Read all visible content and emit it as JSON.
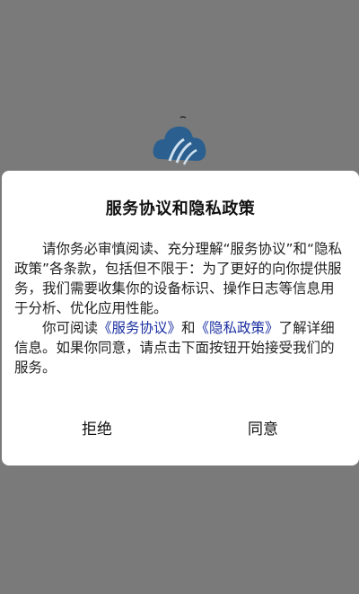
{
  "dialog": {
    "title": "服务协议和隐私政策",
    "paragraph1": "请你务必审慎阅读、充分理解“服务协议”和“隐私政策”各条款，包括但不限于：为了更好的向你提供服务，我们需要收集你的设备标识、操作日志等信息用于分析、优化应用性能。",
    "paragraph2_prefix": "你可阅读",
    "service_link": "《服务协议》",
    "and_text": "和",
    "privacy_link": "《隐私政策》",
    "paragraph2_suffix": "了解详细信息。如果你同意，请点击下面按钮开始接受我们的服务。",
    "reject_label": "拒绝",
    "agree_label": "同意"
  },
  "colors": {
    "overlay": "#7a7a7a",
    "dialog_bg": "#ffffff",
    "link": "#1a2ea0",
    "logo_primary": "#2a5f8f"
  },
  "icons": {
    "app_logo": "cloud-logo-icon"
  }
}
